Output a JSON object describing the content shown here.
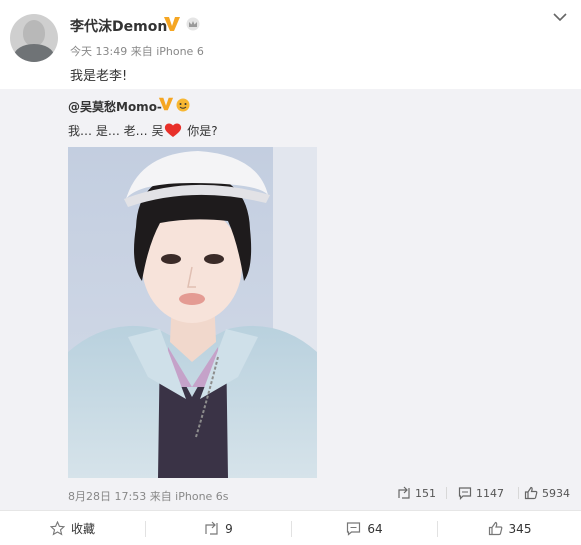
{
  "post": {
    "author": "李代沫Demon",
    "meta": "今天 13:49 来自 iPhone 6",
    "text": "我是老李!"
  },
  "repost": {
    "author": "@吴莫愁Momo-",
    "text_before": "我… 是… 老… 吴",
    "text_after": " 你是?",
    "meta": "8月28日 17:53 来自 iPhone 6s",
    "reposts": "151",
    "comments": "1147",
    "likes": "5934"
  },
  "footer": {
    "favorite_label": "收藏",
    "repost_count": "9",
    "comment_count": "64",
    "like_count": "345"
  },
  "colors": {
    "verified_badge": "#f5a623",
    "heart": "#e8302a",
    "meta_text": "#888888",
    "repost_bg": "#f2f2f5"
  },
  "icons": [
    "verified-v-icon",
    "crown-icon",
    "chevron-down-icon",
    "heart-icon",
    "repost-icon",
    "comment-icon",
    "like-icon",
    "star-icon"
  ]
}
